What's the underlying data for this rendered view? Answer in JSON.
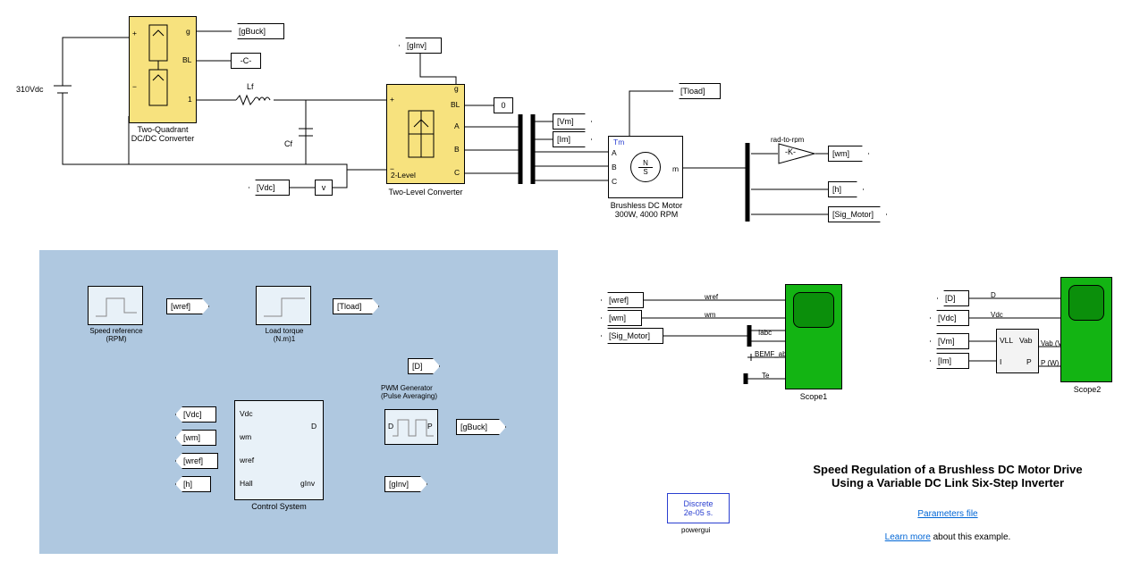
{
  "dc_source": {
    "label": "310Vdc"
  },
  "dcdc": {
    "name": "Two-Quadrant\nDC/DC Converter",
    "ports": {
      "g": "g",
      "bl": "BL",
      "one": "1"
    }
  },
  "inverter": {
    "name": "Two-Level Converter",
    "inside": "2-Level",
    "ports": {
      "g": "g",
      "bl": "BL",
      "a": "A",
      "b": "B",
      "c": "C"
    }
  },
  "lf": "Lf",
  "cf": "Cf",
  "const_C": "-C-",
  "const_0": "0",
  "motor": {
    "name": "Brushless DC Motor\n300W, 4000 RPM",
    "ports": {
      "tm": "Tm",
      "a": "A",
      "b": "B",
      "c": "C",
      "m": "m"
    },
    "magnet": {
      "n": "N",
      "s": "S"
    }
  },
  "rad2rpm": {
    "label": "rad-to-rpm",
    "gain": "-K-"
  },
  "tags": {
    "gBuck": "[gBuck]",
    "gInv": "[gInv]",
    "Vdc": "[Vdc]",
    "Vm": "[Vm]",
    "Im": "[Im]",
    "Tload": "[Tload]",
    "wm": "[wm]",
    "h": "[h]",
    "Sig_Motor": "[Sig_Motor]",
    "wref": "[wref]",
    "D": "[D]"
  },
  "v_meas": "v",
  "panel": {
    "speed_ref": {
      "name": "Speed reference\n(RPM)"
    },
    "load_torque": {
      "name": "Load torque\n(N.m)1"
    },
    "control_system": {
      "name": "Control System",
      "ports": {
        "vdc": "Vdc",
        "wm": "wm",
        "wref": "wref",
        "hall": "Hall",
        "d": "D",
        "ginv": "gInv"
      }
    },
    "pwm": {
      "name": "PWM Generator\n(Pulse Averaging)",
      "ports": {
        "d": "D",
        "p": "P"
      }
    }
  },
  "scope1": {
    "name": "Scope1",
    "signals": {
      "wref": "wref",
      "wm": "wm",
      "iabc": "Iabc",
      "bemf": "BEMF_abc",
      "te": "Te"
    }
  },
  "scope2": {
    "name": "Scope2",
    "signals": {
      "d": "D",
      "vdc": "Vdc",
      "vab": "Vab (V)",
      "p": "P (W)"
    },
    "meas_block": {
      "vll": "VLL",
      "i": "I",
      "vab": "Vab",
      "p": "P"
    }
  },
  "powergui": {
    "line1": "Discrete",
    "line2": "2e-05 s.",
    "label": "powergui"
  },
  "info": {
    "title": "Speed Regulation of a Brushless DC Motor Drive Using a Variable DC Link Six-Step Inverter",
    "params": "Parameters file",
    "learn": "Learn more",
    "about": " about this example."
  }
}
